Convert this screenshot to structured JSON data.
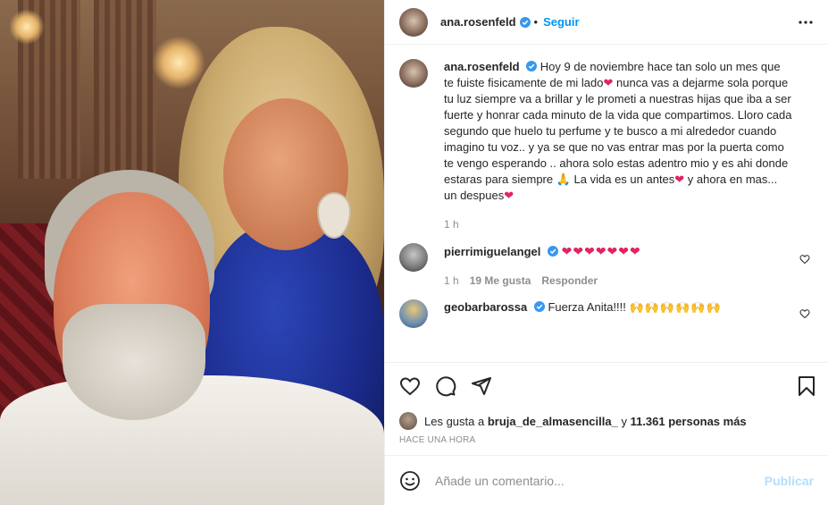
{
  "post": {
    "author": "ana.rosenfeld",
    "separator": "•",
    "follow_label": "Seguir",
    "photo_alt": "selfie of a couple in a restaurant",
    "caption": {
      "username": "ana.rosenfeld",
      "part1": "Hoy 9 de noviembre hace tan solo un mes que te fuiste fisicamente de mi lado",
      "heart1": "❤",
      "part2": " nunca vas a dejarme sola porque tu luz siempre va a brillar y le prometi a nuestras hijas que iba a ser fuerte y honrar cada minuto de la vida que compartimos. Lloro cada segundo que huelo tu perfume y te busco a mi alrededor cuando imagino tu voz.. y ya se que no vas entrar mas por la puerta como te vengo esperando .. ahora solo estas adentro mio y es ahi donde estaras para siempre ",
      "pray": "🙏",
      "part3": " La vida es un antes",
      "heart2": "❤",
      "part4": " y ahora en mas... un despues",
      "heart3": "❤",
      "time": "1 h"
    },
    "comments": [
      {
        "username": "pierrimiguelangel",
        "text": "❤❤❤❤❤❤❤",
        "time": "1 h",
        "likes": "19 Me gusta",
        "reply": "Responder"
      },
      {
        "username": "geobarbarossa",
        "text": "Fuerza Anita!!!!",
        "emojis": "🙌🙌🙌🙌🙌🙌"
      }
    ],
    "likes": {
      "prefix": "Les gusta a",
      "first_user": "bruja_de_almasencilla_",
      "middle": "y",
      "others": "11.361 personas más"
    },
    "posted_ago": "HACE UNA HORA",
    "add_comment": {
      "placeholder": "Añade un comentario...",
      "publish_label": "Publicar"
    }
  },
  "icons": {
    "verified": "verified-badge-icon",
    "more": "more-options-icon",
    "like": "heart-icon",
    "comment": "comment-icon",
    "share": "share-icon",
    "save": "bookmark-icon",
    "emoji": "smile-icon"
  },
  "colors": {
    "accent": "#0095f6",
    "text": "#262626",
    "muted": "#8e8e8e",
    "publish_disabled": "#b2dffc",
    "heart": "#e0245e"
  }
}
